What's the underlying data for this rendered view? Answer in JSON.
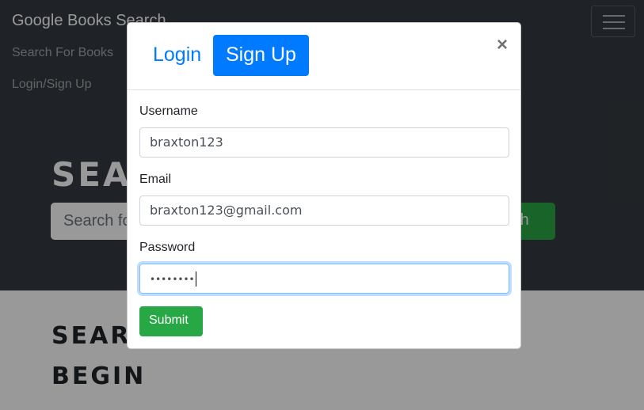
{
  "navbar": {
    "brand": "Google Books Search",
    "links": [
      "Search For Books",
      "Login/Sign Up"
    ],
    "menu_icon": "hamburger-icon"
  },
  "hero": {
    "title": "SEA",
    "search_placeholder": "Search fo",
    "search_button": "rch"
  },
  "results": {
    "title": "SEAR\nBEGIN"
  },
  "modal": {
    "tabs": [
      {
        "label": "Login",
        "active": false
      },
      {
        "label": "Sign Up",
        "active": true
      }
    ],
    "close": "×",
    "fields": [
      {
        "label": "Username",
        "value": "braxton123"
      },
      {
        "label": "Email",
        "value": "braxton123@gmail.com"
      },
      {
        "label": "Password",
        "value": "••••••••"
      }
    ],
    "submit": "Submit"
  },
  "colors": {
    "primary": "#007bff",
    "success": "#28a745",
    "navbar": "#343a40"
  }
}
